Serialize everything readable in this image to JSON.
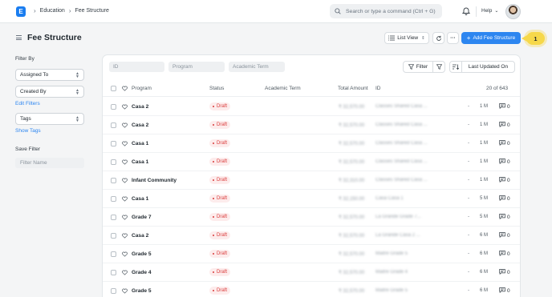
{
  "navbar": {
    "logo_letter": "E",
    "breadcrumbs": [
      "Education",
      "Fee Structure"
    ],
    "search_placeholder": "Search or type a command (Ctrl + G)",
    "help_label": "Help"
  },
  "page": {
    "title": "Fee Structure",
    "list_view_label": "List View",
    "add_button_label": "Add Fee Structure",
    "step_badge": "1"
  },
  "sidebar": {
    "filter_by_label": "Filter By",
    "assigned_to_label": "Assigned To",
    "created_by_label": "Created By",
    "edit_filters_label": "Edit Filters",
    "tags_label": "Tags",
    "show_tags_label": "Show Tags",
    "save_filter_label": "Save Filter",
    "filter_name_placeholder": "Filter Name"
  },
  "filters": {
    "id_placeholder": "ID",
    "program_placeholder": "Program",
    "academic_term_placeholder": "Academic Term",
    "filter_button_label": "Filter",
    "sort_by_label": "Last Updated On"
  },
  "list": {
    "columns": {
      "program": "Program",
      "status": "Status",
      "academic_term": "Academic Term",
      "total_amount": "Total Amount",
      "id": "ID"
    },
    "count_label": "20 of 643",
    "rows": [
      {
        "program": "Casa 2",
        "status": "Draft",
        "total_amount": "₹ 32,570.00",
        "id": "Classes Shared Casa ...",
        "dash": "-",
        "modified": "1 M",
        "comments": "0"
      },
      {
        "program": "Casa 2",
        "status": "Draft",
        "total_amount": "₹ 32,570.00",
        "id": "Classes Shared Casa ...",
        "dash": "-",
        "modified": "1 M",
        "comments": "0"
      },
      {
        "program": "Casa 1",
        "status": "Draft",
        "total_amount": "₹ 32,570.00",
        "id": "Classes Shared Casa ...",
        "dash": "-",
        "modified": "1 M",
        "comments": "0"
      },
      {
        "program": "Casa 1",
        "status": "Draft",
        "total_amount": "₹ 32,570.00",
        "id": "Classes Shared Casa ...",
        "dash": "-",
        "modified": "1 M",
        "comments": "0"
      },
      {
        "program": "Infant Community",
        "status": "Draft",
        "total_amount": "₹ 32,310.00",
        "id": "Classes Shared Casa ...",
        "dash": "-",
        "modified": "1 M",
        "comments": "0"
      },
      {
        "program": "Casa 1",
        "status": "Draft",
        "total_amount": "₹ 32,150.00",
        "id": "Casa Casa 1",
        "dash": "-",
        "modified": "5 M",
        "comments": "0"
      },
      {
        "program": "Grade 7",
        "status": "Draft",
        "total_amount": "₹ 32,570.00",
        "id": "La Grande Grade 7...",
        "dash": "-",
        "modified": "5 M",
        "comments": "0"
      },
      {
        "program": "Casa 2",
        "status": "Draft",
        "total_amount": "₹ 32,570.00",
        "id": "La Grande Casa 2 ...",
        "dash": "-",
        "modified": "6 M",
        "comments": "0"
      },
      {
        "program": "Grade 5",
        "status": "Draft",
        "total_amount": "₹ 32,570.00",
        "id": "Maitre Grade 5",
        "dash": "-",
        "modified": "6 M",
        "comments": "0"
      },
      {
        "program": "Grade 4",
        "status": "Draft",
        "total_amount": "₹ 32,570.00",
        "id": "Maitre Grade 4",
        "dash": "-",
        "modified": "6 M",
        "comments": "0"
      },
      {
        "program": "Grade 5",
        "status": "Draft",
        "total_amount": "₹ 32,570.00",
        "id": "Maitre Grade 5",
        "dash": "-",
        "modified": "6 M",
        "comments": "0"
      }
    ]
  },
  "colors": {
    "primary": "#2d86f0",
    "draft_text": "#d93a3a",
    "draft_bg": "#fdecec",
    "step_badge": "#f6d84a"
  }
}
